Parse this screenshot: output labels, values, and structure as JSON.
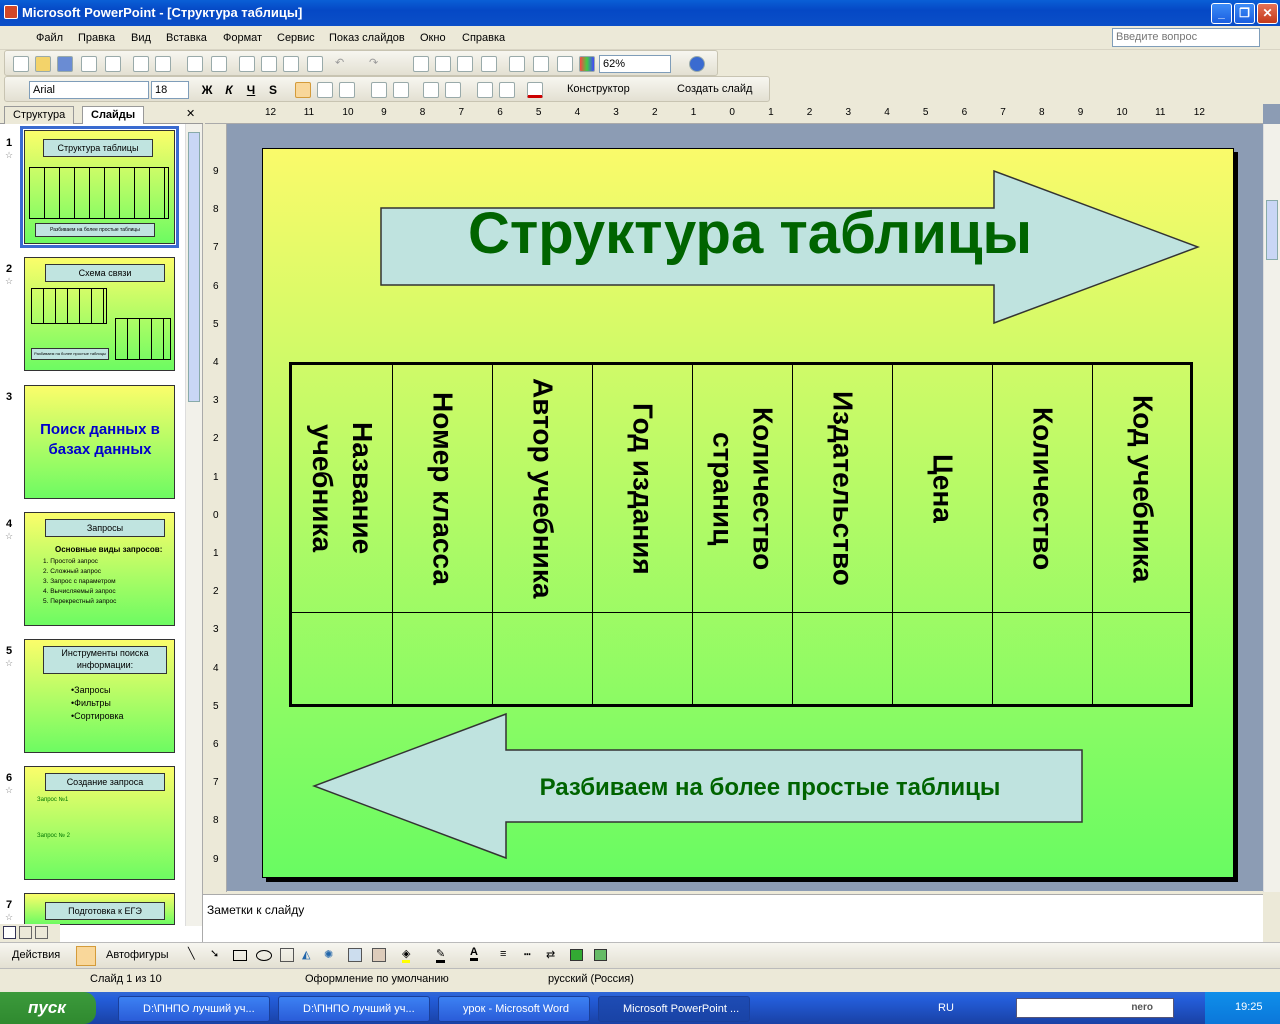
{
  "window": {
    "title": "Microsoft PowerPoint - [Структура таблицы]"
  },
  "menu": [
    "Файл",
    "Правка",
    "Вид",
    "Вставка",
    "Формат",
    "Сервис",
    "Показ слайдов",
    "Окно",
    "Справка"
  ],
  "ask_placeholder": "Введите вопрос",
  "toolbar": {
    "zoom": "62%",
    "font": "Arial",
    "size": "18",
    "bold": "Ж",
    "italic": "К",
    "underline": "Ч",
    "shadow": "S",
    "designer": "Конструктор",
    "new_slide": "Создать слайд"
  },
  "tabs": {
    "outline": "Структура",
    "slides": "Слайды"
  },
  "thumbnails": [
    {
      "num": "1",
      "title": "Структура таблицы",
      "footer": "Разбиваем на более простые таблицы"
    },
    {
      "num": "2",
      "title": "Схема связи",
      "footer": "Разбиваем на более простые таблицы"
    },
    {
      "num": "3",
      "title": "Поиск данных в базах данных"
    },
    {
      "num": "4",
      "title": "Запросы",
      "subtitle": "Основные виды запросов:",
      "items": [
        "1. Простой запрос",
        "2. Сложный запрос",
        "3. Запрос с параметром",
        "4. Вычисляемый запрос",
        "5. Перекрестный запрос"
      ]
    },
    {
      "num": "5",
      "title": "Инструменты поиска информации:",
      "items": [
        "•Запросы",
        "•Фильтры",
        "•Сортировка"
      ]
    },
    {
      "num": "6",
      "title": "Создание запроса",
      "q1": "Запрос №1",
      "q2": "Запрос № 2"
    },
    {
      "num": "7",
      "title": "Подготовка к ЕГЭ"
    }
  ],
  "slide": {
    "title": "Структура таблицы",
    "columns": [
      "Название учебника",
      "Номер класса",
      "Автор учебника",
      "Год издания",
      "Количество страниц",
      "Издательство",
      "Цена",
      "Количество",
      "Код учебника"
    ],
    "bottom_arrow_text": "Разбиваем на более простые таблицы"
  },
  "ruler_h": [
    "12",
    "11",
    "10",
    "9",
    "8",
    "7",
    "6",
    "5",
    "4",
    "3",
    "2",
    "1",
    "0",
    "1",
    "2",
    "3",
    "4",
    "5",
    "6",
    "7",
    "8",
    "9",
    "10",
    "11",
    "12"
  ],
  "ruler_v": [
    "9",
    "8",
    "7",
    "6",
    "5",
    "4",
    "3",
    "2",
    "1",
    "0",
    "1",
    "2",
    "3",
    "4",
    "5",
    "6",
    "7",
    "8",
    "9"
  ],
  "notes_placeholder": "Заметки к слайду",
  "drawing": {
    "actions": "Действия",
    "autoshapes": "Автофигуры"
  },
  "status": {
    "slide": "Слайд 1 из 10",
    "design": "Оформление по умолчанию",
    "language": "русский (Россия)"
  },
  "taskbar": {
    "start": "пуск",
    "tasks": [
      "D:\\ПНПО лучший уч...",
      "D:\\ПНПО лучший уч...",
      "урок - Microsoft Word",
      "Microsoft PowerPoint ..."
    ],
    "lang": "RU",
    "time": "19:25",
    "search_brand": "nero"
  }
}
